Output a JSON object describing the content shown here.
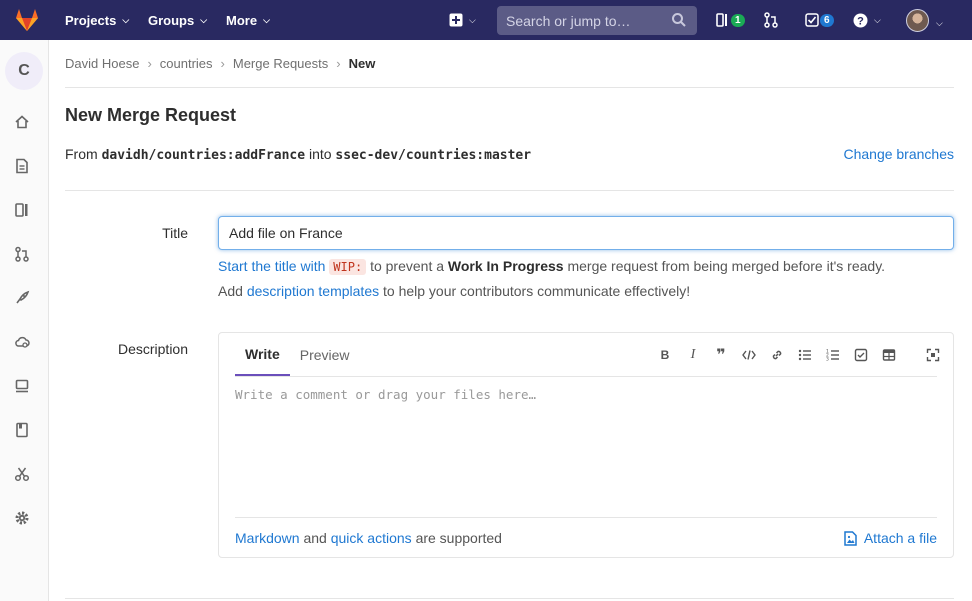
{
  "navbar": {
    "projects": "Projects",
    "groups": "Groups",
    "more": "More",
    "search_placeholder": "Search or jump to…",
    "issues_count": "1",
    "todos_count": "6"
  },
  "sidebar": {
    "project_letter": "C"
  },
  "breadcrumb": {
    "items": [
      "David Hoese",
      "countries",
      "Merge Requests",
      "New"
    ]
  },
  "page": {
    "title": "New Merge Request",
    "from_label": "From",
    "source_branch": "davidh/countries:addFrance",
    "into_label": "into",
    "target_branch": "ssec-dev/countries:master",
    "change_branches": "Change branches"
  },
  "form": {
    "title_label": "Title",
    "title_value": "Add file on France",
    "wip_hint": {
      "link_text": "Start the title with",
      "code": "WIP:",
      "middle": "to prevent a",
      "bold": "Work In Progress",
      "end": "merge request from being merged before it's ready."
    },
    "template_hint": {
      "start": "Add",
      "link_text": "description templates",
      "end": "to help your contributors communicate effectively!"
    },
    "description_label": "Description",
    "tabs": [
      "Write",
      "Preview"
    ],
    "textarea_placeholder": "Write a comment or drag your files here…",
    "footer": {
      "markdown": "Markdown",
      "and": "and",
      "quick_actions": "quick actions",
      "supported": "are supported",
      "attach": "Attach a file"
    }
  },
  "colors": {
    "navbar": "#292961",
    "link": "#1f78d1",
    "active_tab": "#6b4fbb"
  }
}
